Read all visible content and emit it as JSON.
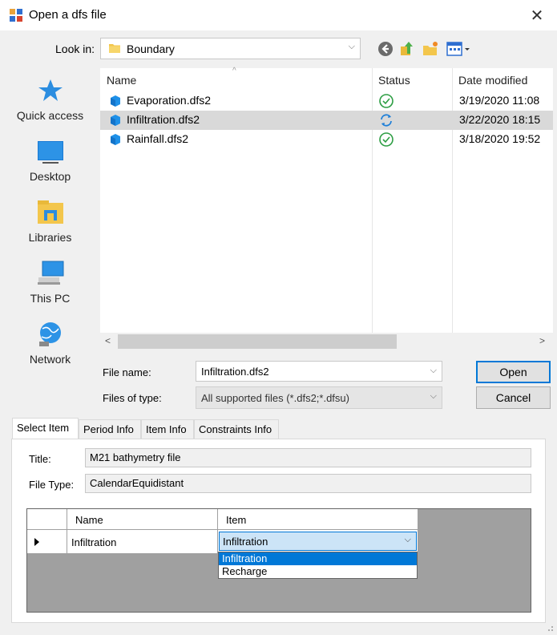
{
  "window": {
    "title": "Open a dfs file",
    "close_icon": "close-icon",
    "app_icon": "app-icon"
  },
  "lookin": {
    "label": "Look in:",
    "value": "Boundary",
    "icon": "folder-icon"
  },
  "toolbar": {
    "icons": [
      "back-icon",
      "up-folder-icon",
      "new-folder-icon",
      "view-menu-icon"
    ]
  },
  "places": [
    {
      "label": "Quick access",
      "icon": "star-icon"
    },
    {
      "label": "Desktop",
      "icon": "desktop-icon"
    },
    {
      "label": "Libraries",
      "icon": "libraries-icon"
    },
    {
      "label": "This PC",
      "icon": "computer-icon"
    },
    {
      "label": "Network",
      "icon": "network-icon"
    }
  ],
  "filelist": {
    "columns": [
      "Name",
      "Status",
      "Date modified"
    ],
    "rows": [
      {
        "name": "Evaporation.dfs2",
        "status": "synced",
        "date": "3/19/2020 11:08",
        "selected": false
      },
      {
        "name": "Infiltration.dfs2",
        "status": "syncing",
        "date": "3/22/2020 18:15",
        "selected": true
      },
      {
        "name": "Rainfall.dfs2",
        "status": "synced",
        "date": "3/18/2020 19:52",
        "selected": false
      }
    ]
  },
  "filename": {
    "label": "File name:",
    "value": "Infiltration.dfs2"
  },
  "filetype": {
    "label": "Files of type:",
    "value": "All supported files  (*.dfs2;*.dfsu)"
  },
  "buttons": {
    "open": "Open",
    "cancel": "Cancel"
  },
  "tabs": [
    "Select Item",
    "Period Info",
    "Item Info",
    "Constraints Info"
  ],
  "select_item": {
    "title_label": "Title:",
    "title_value": "M21 bathymetry file",
    "filetype_label": "File Type:",
    "filetype_value": "CalendarEquidistant",
    "grid": {
      "headers": [
        "Name",
        "Item"
      ],
      "row": {
        "name": "Infiltration",
        "item": "Infiltration"
      },
      "dropdown_options": [
        "Infiltration",
        "Recharge"
      ],
      "highlighted": "Infiltration"
    }
  },
  "colors": {
    "accent": "#0078d7",
    "selected_row": "#d9d9d9",
    "grid_bg": "#a0a0a0",
    "sync_ok": "#2e9e44",
    "sync_blue": "#1e7fd8"
  }
}
